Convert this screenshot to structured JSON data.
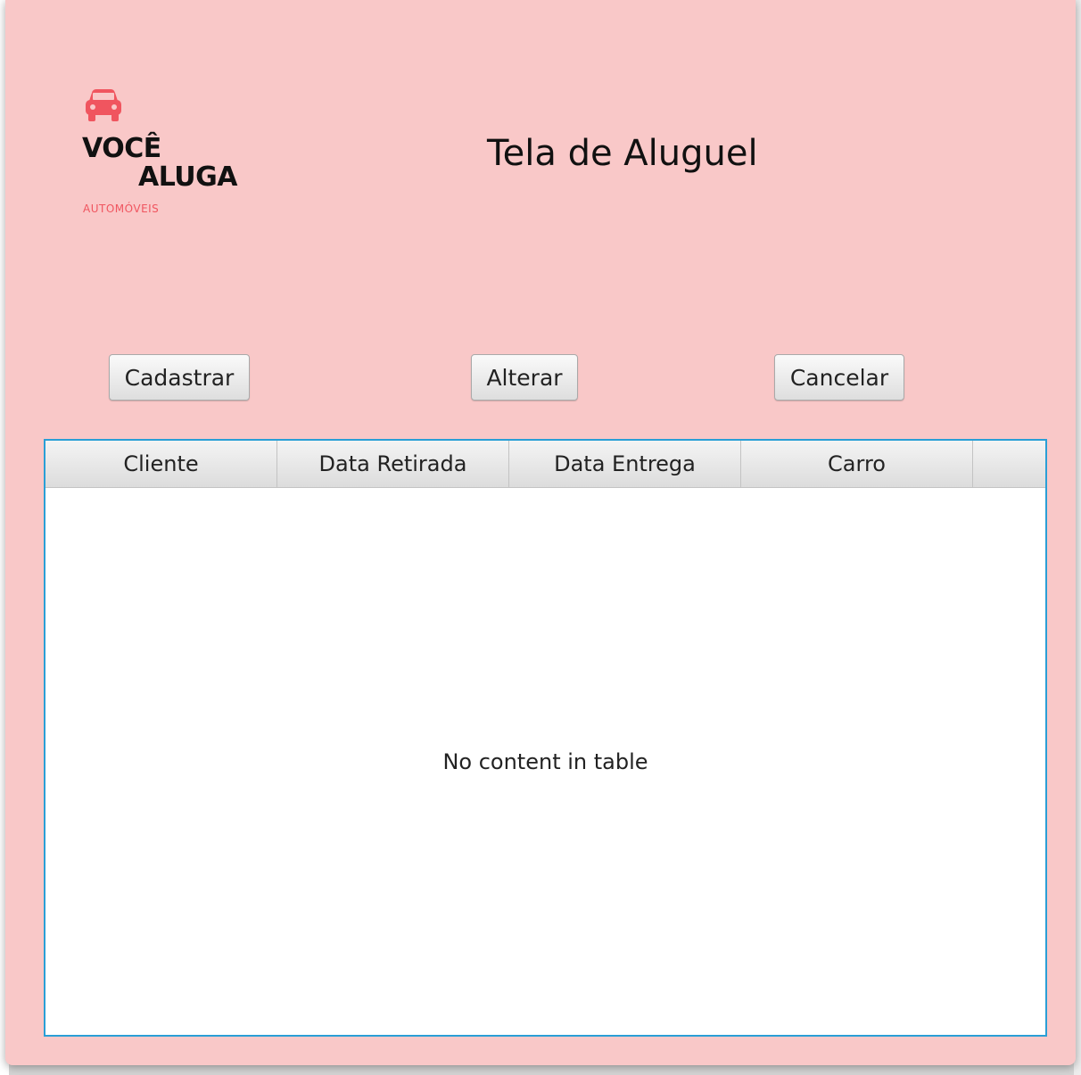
{
  "window": {
    "title": "Tela de Aluguel",
    "background_color": "#f9c8c8"
  },
  "logo": {
    "icon": "car-icon",
    "line1": "VOCÊ",
    "line2": "ALUGA",
    "tagline": "AUTOMÓVEIS",
    "accent_color": "#f0555f"
  },
  "buttons": {
    "cadastrar": "Cadastrar",
    "alterar": "Alterar",
    "cancelar": "Cancelar"
  },
  "table": {
    "columns": [
      "Cliente",
      "Data Retirada",
      "Data Entrega",
      "Carro"
    ],
    "rows": [],
    "placeholder": "No content in table",
    "focus_border_color": "#2a9fd6"
  }
}
